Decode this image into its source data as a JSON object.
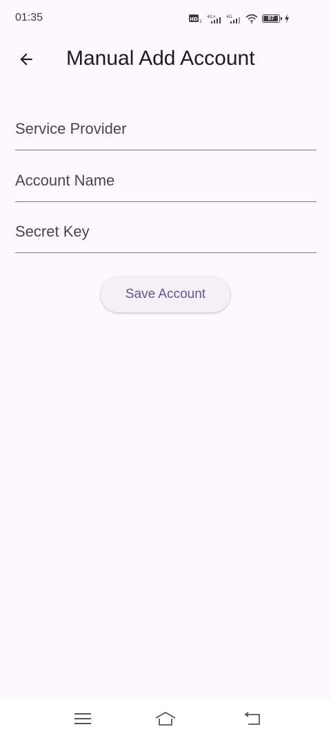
{
  "status_bar": {
    "time": "01:35",
    "battery_level": "87",
    "icons": [
      "hd-icon",
      "signal-4g-plus-icon",
      "signal-4g-icon",
      "wifi-icon",
      "battery-icon",
      "charging-icon"
    ]
  },
  "app_bar": {
    "title": "Manual Add Account",
    "back_icon": "arrow-back-icon"
  },
  "form": {
    "service_provider": {
      "placeholder": "Service Provider",
      "value": ""
    },
    "account_name": {
      "placeholder": "Account Name",
      "value": ""
    },
    "secret_key": {
      "placeholder": "Secret Key",
      "value": ""
    },
    "save_label": "Save Account"
  },
  "nav_bar": {
    "items": [
      "menu-icon",
      "home-icon",
      "back-icon"
    ]
  },
  "colors": {
    "background": "#fdf7fe",
    "accent": "#65558f",
    "button_bg": "#f5eff7",
    "underline": "#79747e"
  }
}
